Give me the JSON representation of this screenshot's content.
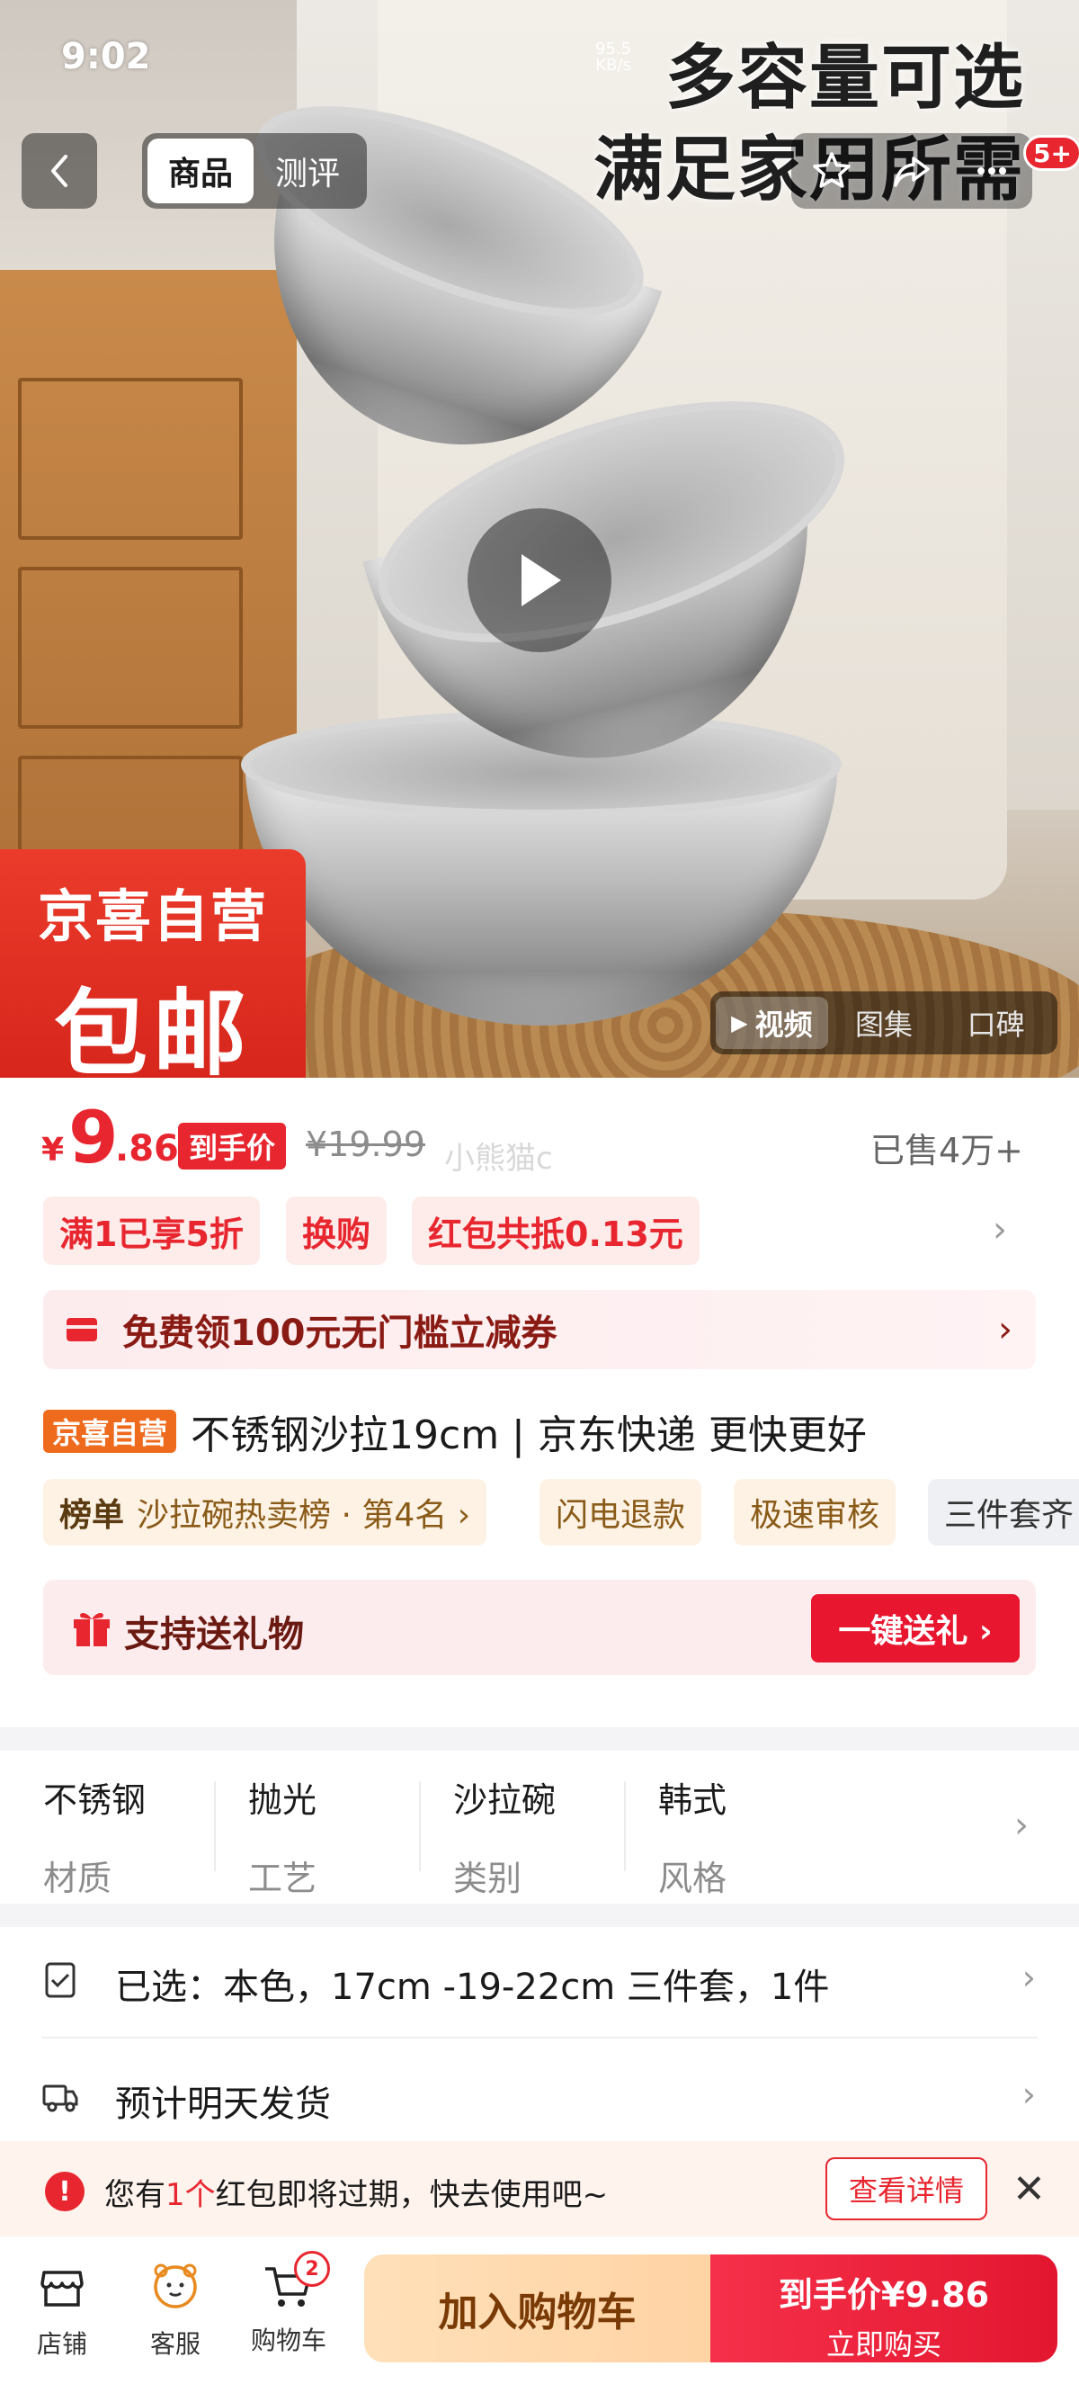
{
  "status_bar": {
    "time": "9:02",
    "net_speed": "95.5",
    "net_unit": "KB/s",
    "battery": "%"
  },
  "hero": {
    "headline_line1": "多容量可选",
    "headline_line2": "满足家用所需",
    "tabs": [
      "商品",
      "测评"
    ],
    "notif_count": "5+",
    "badge_line1": "京喜自营",
    "badge_line2": "包邮",
    "media_tabs": [
      "视频",
      "图集",
      "口碑"
    ]
  },
  "price": {
    "currency": "¥",
    "integer": "9",
    "decimal": ".86",
    "tag": "到手价",
    "original": "¥19.99",
    "watermark": "小熊猫c",
    "sold": "已售4万+"
  },
  "promos": [
    "满1已享5折",
    "换购",
    "红包共抵0.13元"
  ],
  "coupon": {
    "text": "免费领100元无门槛立减券"
  },
  "product": {
    "store_tag": "京喜自营",
    "title": "不锈钢沙拉19cm | 京东快递 更快更好"
  },
  "chips": {
    "rank_label": "榜单",
    "rank_text": "沙拉碗热卖榜 · 第4名 ›",
    "items": [
      "闪电退款",
      "极速审核",
      "三件套齐"
    ]
  },
  "gift": {
    "text": "支持送礼物",
    "button": "一键送礼 ›"
  },
  "attributes": [
    {
      "value": "不锈钢",
      "key": "材质"
    },
    {
      "value": "抛光",
      "key": "工艺"
    },
    {
      "value": "沙拉碗",
      "key": "类别"
    },
    {
      "value": "韩式",
      "key": "风格"
    }
  ],
  "selected": {
    "text": "已选：本色，17cm -19-22cm 三件套，1件"
  },
  "shipping": {
    "text": "预计明天发货"
  },
  "notice": {
    "prefix": "您有",
    "count": "1个",
    "suffix": "红包即将过期，快去使用吧~",
    "button": "查看详情"
  },
  "bottom_bar": {
    "store": "店铺",
    "service": "客服",
    "cart": "购物车",
    "cart_count": "2",
    "add_to_cart": "加入购物车",
    "buy_price_label": "到手价",
    "buy_price": "¥9.86",
    "buy_now": "立即购买"
  },
  "colors": {
    "accent": "#e8262f",
    "store_tag": "#ee6a1c",
    "add_cart_bg": "#ffd9ad"
  }
}
